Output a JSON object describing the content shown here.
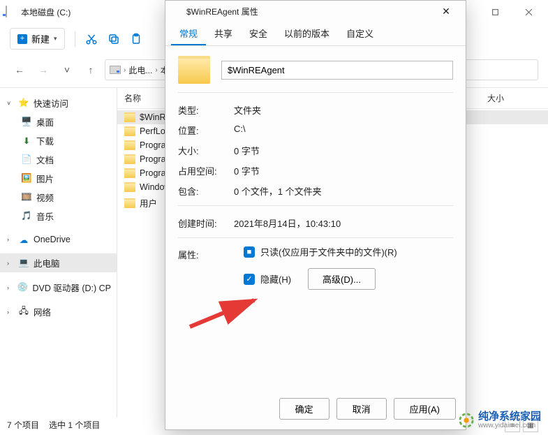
{
  "explorer": {
    "window_title": "本地磁盘 (C:)",
    "new_button": "新建",
    "breadcrumb": {
      "seg1": "此电...",
      "seg2": "本..."
    },
    "sidebar": {
      "quick": "快速访问",
      "desktop": "桌面",
      "downloads": "下载",
      "documents": "文档",
      "pictures": "图片",
      "videos": "视频",
      "music": "音乐",
      "onedrive": "OneDrive",
      "thispc": "此电脑",
      "dvd": "DVD 驱动器 (D:) CP",
      "network": "网络"
    },
    "columns": {
      "name": "名称",
      "size": "大小"
    },
    "files": {
      "f0": "$WinREA...",
      "f1": "PerfLogs",
      "f2": "Program...",
      "f3": "Program...",
      "f4": "Program...",
      "f5": "Windows...",
      "f6": "用户"
    },
    "status": {
      "count": "7 个项目",
      "selected": "选中 1 个项目"
    }
  },
  "dialog": {
    "title": "$WinREAgent 属性",
    "tabs": {
      "general": "常规",
      "sharing": "共享",
      "security": "安全",
      "previous": "以前的版本",
      "custom": "自定义"
    },
    "name_value": "$WinREAgent",
    "rows": {
      "type_l": "类型:",
      "type_v": "文件夹",
      "loc_l": "位置:",
      "loc_v": "C:\\",
      "size_l": "大小:",
      "size_v": "0 字节",
      "disk_l": "占用空间:",
      "disk_v": "0 字节",
      "contains_l": "包含:",
      "contains_v": "0 个文件，1 个文件夹",
      "created_l": "创建时间:",
      "created_v": "2021年8月14日，10:43:10",
      "attr_l": "属性:",
      "readonly": "只读(仅应用于文件夹中的文件)(R)",
      "hidden": "隐藏(H)",
      "advanced": "高级(D)..."
    },
    "buttons": {
      "ok": "确定",
      "cancel": "取消",
      "apply": "应用(A)"
    }
  },
  "watermark": {
    "title": "纯净系统家园",
    "url": "www.yidaimei.com"
  }
}
